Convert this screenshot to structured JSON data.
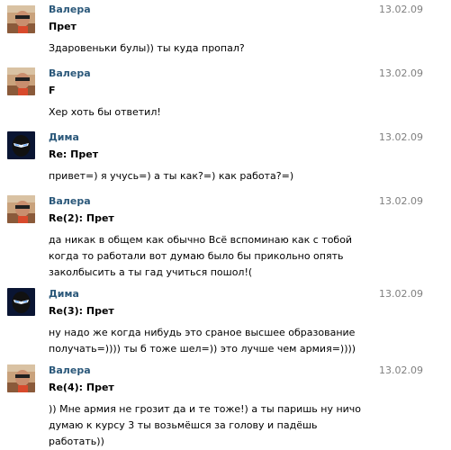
{
  "messages": [
    {
      "author": "Валера",
      "date": "13.02.09",
      "subject": "Прет",
      "avatar": "photo-sunglasses",
      "text": "Здаровеньки булы)) ты куда пропал?"
    },
    {
      "author": "Валера",
      "date": "13.02.09",
      "subject": "F",
      "avatar": "photo-sunglasses",
      "text": "Хер хоть бы ответил!"
    },
    {
      "author": "Дима",
      "date": "13.02.09",
      "subject": "Re: Прет",
      "avatar": "ninja-mask",
      "text": "привет=) я учусь=) а ты как?=) как работа?=)"
    },
    {
      "author": "Валера",
      "date": "13.02.09",
      "subject": "Re(2): Прет",
      "avatar": "photo-sunglasses",
      "text": "да никак в общем как обычно Всё вспоминаю как с тобой когда то работали вот думаю было бы прикольно опять заколбысить а ты гад учиться пошол!("
    },
    {
      "author": "Дима",
      "date": "13.02.09",
      "subject": "Re(3): Прет",
      "avatar": "ninja-mask",
      "text": "ну надо же когда нибудь это сраное высшее образование получать=)))) ты б тоже шел=)) это лучше чем армия=))))"
    },
    {
      "author": "Валера",
      "date": "13.02.09",
      "subject": "Re(4): Прет",
      "avatar": "photo-sunglasses",
      "text": ")) Мне армия не грозит да и те тоже!) а ты паришь ну ничо думаю к курсу 3 ты возьмёшся за голову и падёшь работать))"
    }
  ],
  "colors": {
    "author": "#2b587a",
    "date": "#808080",
    "text": "#000000",
    "background": "#ffffff"
  }
}
